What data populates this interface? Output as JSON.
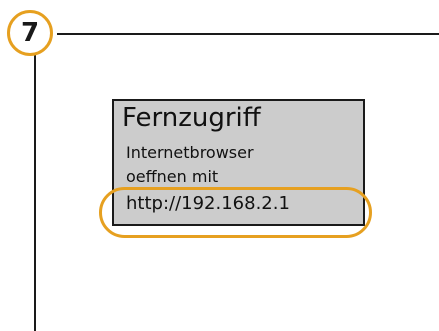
{
  "step": {
    "number": "7"
  },
  "display": {
    "title": "Fernzugriff",
    "line1": "Internetbrowser",
    "line2": "oeffnen mit",
    "url": "http://192.168.2.1"
  },
  "colors": {
    "accent": "#e6a020",
    "panel_background": "#cccccc",
    "line": "#1a1a1a"
  }
}
